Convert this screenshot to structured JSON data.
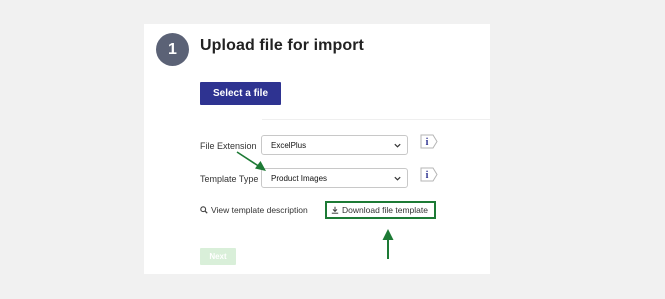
{
  "step": {
    "number": "1",
    "title": "Upload file for import"
  },
  "select_file_button": "Select a file",
  "file_extension": {
    "label": "File Extension",
    "value": "ExcelPlus"
  },
  "template_type": {
    "label": "Template Type",
    "value": "Product Images"
  },
  "links": {
    "view_description": "View template description",
    "download_template": "Download file template"
  },
  "next_button": "Next",
  "colors": {
    "step_circle": "#5b6276",
    "primary_button": "#2e3391",
    "annotation_green": "#1d7a35",
    "next_disabled": "#d9efd9"
  },
  "icons": {
    "info": "info-icon",
    "search": "search-icon",
    "download": "download-icon",
    "chevron": "chevron-down-icon"
  }
}
